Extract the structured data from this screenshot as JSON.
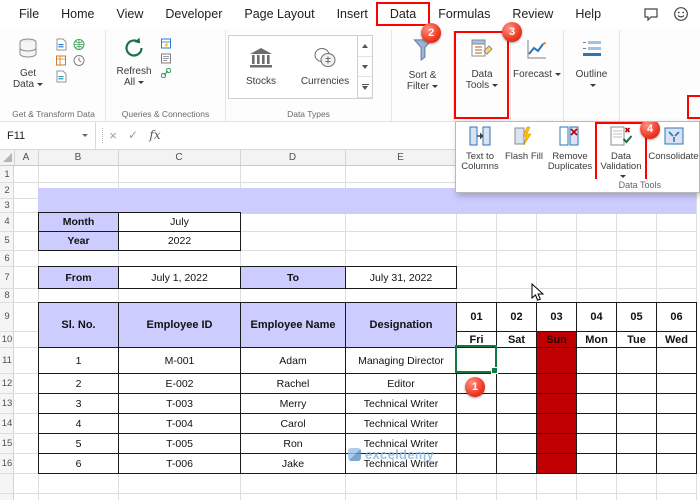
{
  "menubar": {
    "tabs": [
      "File",
      "Home",
      "View",
      "Developer",
      "Page Layout",
      "Insert",
      "Data",
      "Formulas",
      "Review",
      "Help"
    ]
  },
  "ribbon": {
    "get_data_label": "Get Data",
    "refresh_label": "Refresh All",
    "stocks_label": "Stocks",
    "currencies_label": "Currencies",
    "sort_filter_label": "Sort & Filter",
    "data_tools_label": "Data Tools",
    "forecast_label": "Forecast",
    "outline_label": "Outline",
    "groups": [
      "Get & Transform Data",
      "Queries & Connections",
      "Data Types"
    ]
  },
  "flyout": {
    "text_to_columns": "Text to Columns",
    "flash_fill": "Flash Fill",
    "remove_duplicates": "Remove Duplicates",
    "data_validation": "Data Validation",
    "consolidate": "Consolidate",
    "group_label": "Data Tools"
  },
  "formula_bar": {
    "cell_ref": "F11",
    "cancel_glyph": "×",
    "enter_glyph": "✓",
    "fx_label": "fx"
  },
  "sheet": {
    "col_letters": [
      "A",
      "B",
      "C",
      "D",
      "E"
    ],
    "row_numbers": [
      "1",
      "2",
      "3",
      "4",
      "5",
      "6",
      "7",
      "8",
      "9",
      "10",
      "11",
      "12",
      "13",
      "14",
      "15",
      "16"
    ],
    "month_label": "Month",
    "month_value": "July",
    "year_label": "Year",
    "year_value": "2022",
    "from_label": "From",
    "from_value": "July 1, 2022",
    "to_label": "To",
    "to_value": "July 31, 2022",
    "table": {
      "headers": [
        "Sl. No.",
        "Employee ID",
        "Employee Name",
        "Designation"
      ],
      "day_numbers": [
        "01",
        "02",
        "03",
        "04",
        "05",
        "06"
      ],
      "day_names": [
        "Fri",
        "Sat",
        "Sun",
        "Mon",
        "Tue",
        "Wed"
      ],
      "rows": [
        {
          "sl": "1",
          "id": "M-001",
          "name": "Adam",
          "designation": "Managing Director"
        },
        {
          "sl": "2",
          "id": "E-002",
          "name": "Rachel",
          "designation": "Editor"
        },
        {
          "sl": "3",
          "id": "T-003",
          "name": "Merry",
          "designation": "Technical Writer"
        },
        {
          "sl": "4",
          "id": "T-004",
          "name": "Carol",
          "designation": "Technical Writer"
        },
        {
          "sl": "5",
          "id": "T-005",
          "name": "Ron",
          "designation": "Technical Writer"
        },
        {
          "sl": "6",
          "id": "T-006",
          "name": "Jake",
          "designation": "Technical Writer"
        }
      ]
    }
  },
  "annotations": {
    "step1": "1",
    "step2": "2",
    "step3": "3",
    "step4": "4"
  },
  "watermark": {
    "text": "exceldemy"
  },
  "colors": {
    "highlight_red": "#ff0000",
    "header_fill": "#ccccff",
    "weekend_fill": "#c00000",
    "selection_green": "#107c41"
  }
}
